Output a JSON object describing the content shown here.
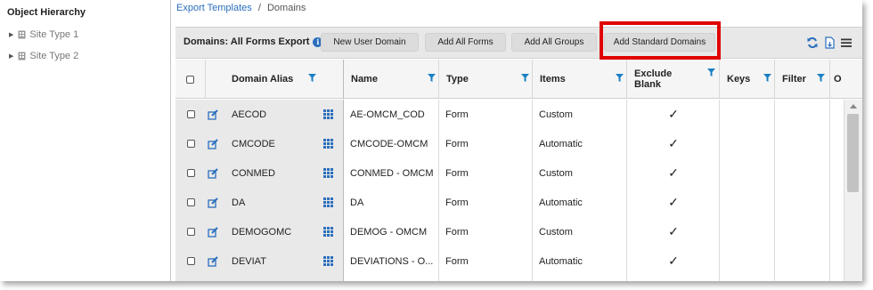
{
  "left_panel": {
    "title": "Object Hierarchy",
    "items": [
      {
        "label": "Site Type 1"
      },
      {
        "label": "Site Type 2"
      }
    ]
  },
  "breadcrumb": {
    "parent": "Export Templates",
    "separator": "/",
    "current": "Domains"
  },
  "toolbar": {
    "title": "Domains: All Forms Export",
    "buttons": {
      "new_user_domain": "New User Domain",
      "add_all_forms": "Add All Forms",
      "add_all_groups": "Add All Groups",
      "add_standard_domains": "Add Standard Domains"
    }
  },
  "columns": {
    "domain_alias": "Domain Alias",
    "name": "Name",
    "type": "Type",
    "items": "Items",
    "exclude_blank_1": "Exclude",
    "exclude_blank_2": "Blank",
    "keys": "Keys",
    "filter": "Filter",
    "overflow": "O"
  },
  "rows": [
    {
      "alias": "AECOD",
      "name": "AE-OMCM_COD",
      "type": "Form",
      "items": "Custom",
      "exclude": "✓"
    },
    {
      "alias": "CMCODE",
      "name": "CMCODE-OMCM",
      "type": "Form",
      "items": "Automatic",
      "exclude": "✓"
    },
    {
      "alias": "CONMED",
      "name": "CONMED - OMCM",
      "type": "Form",
      "items": "Custom",
      "exclude": "✓"
    },
    {
      "alias": "DA",
      "name": "DA",
      "type": "Form",
      "items": "Automatic",
      "exclude": "✓"
    },
    {
      "alias": "DEMOGOMC",
      "name": "DEMOG - OMCM",
      "type": "Form",
      "items": "Custom",
      "exclude": "✓"
    },
    {
      "alias": "DEVIAT",
      "name": "DEVIATIONS - O...",
      "type": "Form",
      "items": "Automatic",
      "exclude": "✓"
    }
  ],
  "colors": {
    "link": "#2a6ebd",
    "highlight": "#e00000",
    "filter_icon": "#1a7fc4"
  }
}
